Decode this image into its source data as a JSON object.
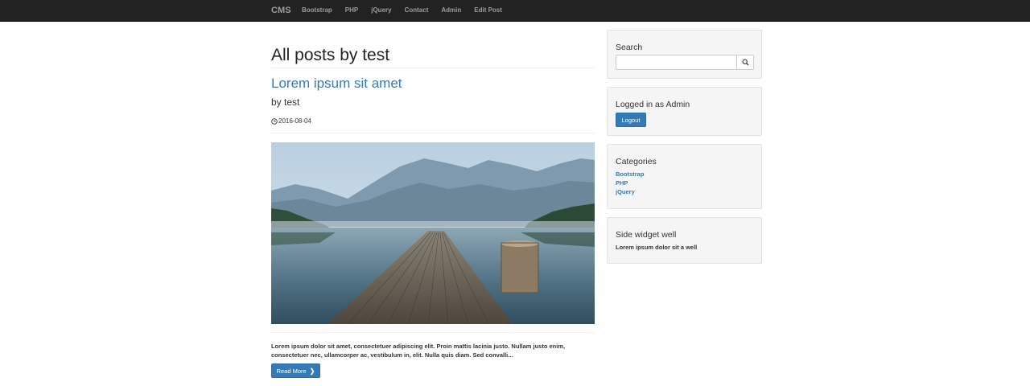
{
  "navbar": {
    "brand": "CMS",
    "links": [
      {
        "label": "Bootstrap"
      },
      {
        "label": "PHP"
      },
      {
        "label": "jQuery"
      },
      {
        "label": "Contact"
      },
      {
        "label": "Admin"
      },
      {
        "label": "Edit Post"
      }
    ]
  },
  "main": {
    "page_title": "All posts by test",
    "post": {
      "title": "Lorem ipsum sit amet",
      "byline": "by test",
      "date": "2016-08-04",
      "date_icon": "clock-icon",
      "image_alt": "lake-dock-photo",
      "excerpt": "Lorem ipsum dolor sit amet, consectetuer adipiscing elit. Proin mattis lacinia justo. Nullam justo enim, consectetuer nec, ullamcorper ac, vestibulum in, elit. Nulla quis diam. Sed convalli...",
      "read_more_label": "Read More",
      "read_more_icon": "chevron-right-icon"
    }
  },
  "sidebar": {
    "search": {
      "title": "Search",
      "value": "",
      "button_icon": "search-icon"
    },
    "login": {
      "title": "Logged in as Admin",
      "logout_label": "Logout"
    },
    "categories": {
      "title": "Categories",
      "items": [
        {
          "label": "Bootstrap"
        },
        {
          "label": "PHP"
        },
        {
          "label": "jQuery"
        }
      ]
    },
    "widget": {
      "title": "Side widget well",
      "text": "Lorem ipsum dolor sit a well"
    }
  },
  "colors": {
    "navbar_bg": "#222222",
    "nav_text": "#9d9d9d",
    "link": "#337ab7",
    "button_primary": "#337ab7",
    "well_bg": "#f5f5f5"
  }
}
